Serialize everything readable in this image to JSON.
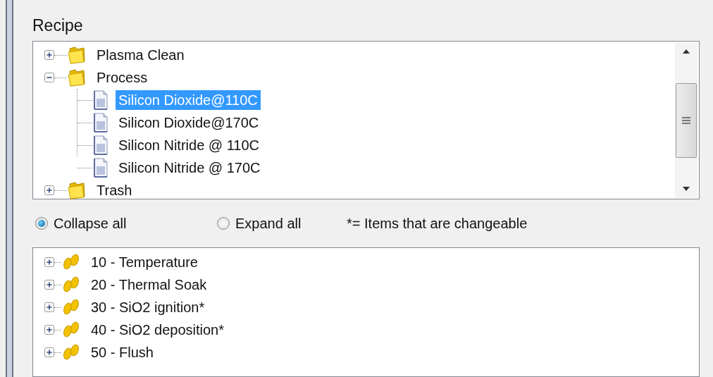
{
  "group_title": "Recipe",
  "recipe_tree": [
    {
      "label": "Plasma Clean",
      "kind": "folder",
      "expanded": false,
      "selected": false
    },
    {
      "label": "Process",
      "kind": "folder",
      "expanded": true,
      "selected": false,
      "children": [
        {
          "label": "Silicon Dioxide@110C",
          "kind": "file",
          "selected": true
        },
        {
          "label": "Silicon Dioxide@170C",
          "kind": "file",
          "selected": false
        },
        {
          "label": "Silicon Nitride @ 110C",
          "kind": "file",
          "selected": false
        },
        {
          "label": "Silicon Nitride @ 170C",
          "kind": "file",
          "selected": false
        }
      ]
    },
    {
      "label": "Trash",
      "kind": "folder",
      "expanded": false,
      "selected": false
    }
  ],
  "view_options": [
    {
      "label": "Collapse all",
      "selected": true
    },
    {
      "label": "Expand all",
      "selected": false
    }
  ],
  "legend": "*= Items that are changeable",
  "steps": [
    {
      "label": "10 - Temperature",
      "expanded": false
    },
    {
      "label": "20 - Thermal Soak",
      "expanded": false
    },
    {
      "label": "30 - SiO2 ignition*",
      "expanded": false
    },
    {
      "label": "40 - SiO2 deposition*",
      "expanded": false
    },
    {
      "label": "50 - Flush",
      "expanded": false
    }
  ]
}
